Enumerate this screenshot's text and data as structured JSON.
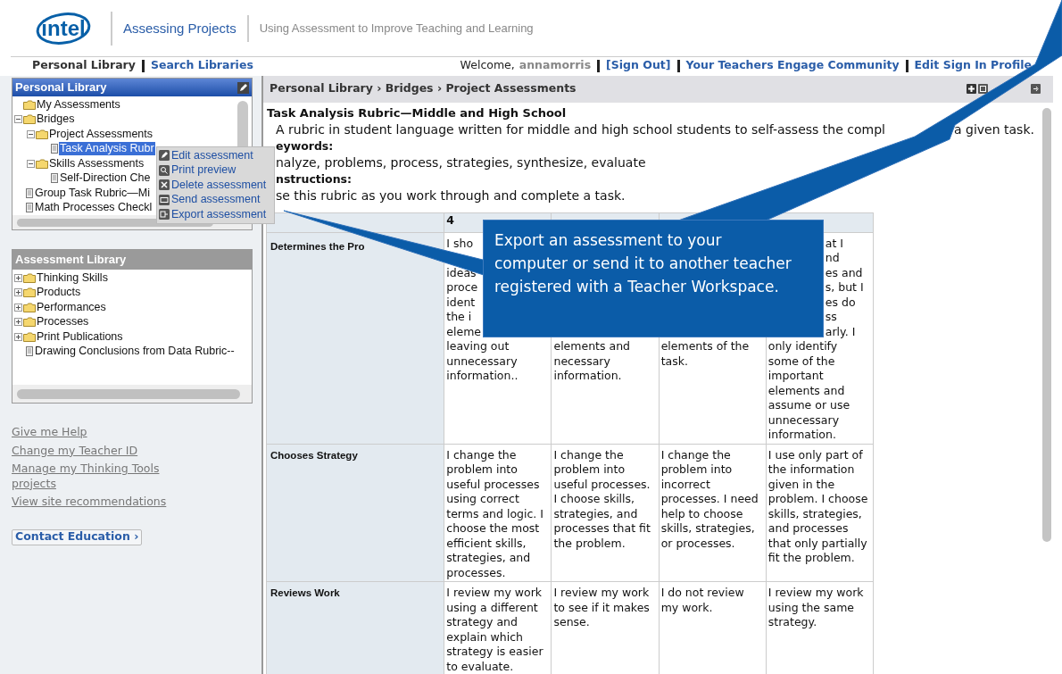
{
  "header": {
    "logo": "intel",
    "site_title": "Assessing Projects",
    "tagline": "Using Assessment to Improve Teaching and Learning"
  },
  "nav": {
    "tabs": [
      {
        "label": "Personal Library",
        "selected": true
      },
      {
        "label": "Search Libraries",
        "selected": false
      }
    ],
    "welcome": "Welcome,",
    "user": "annamorris",
    "links": [
      "[Sign Out]",
      "Your Teachers Engage Community",
      "Edit Sign In Profile"
    ]
  },
  "personal_library": {
    "title": "Personal Library",
    "tree": [
      {
        "label": "My Assessments",
        "kind": "folder",
        "selected": false
      },
      {
        "label": "Bridges",
        "kind": "folder",
        "expanded": true,
        "selected": false,
        "children": [
          {
            "label": "Project Assessments",
            "kind": "folder",
            "expanded": true,
            "selected": false,
            "children": [
              {
                "label": "Task Analysis Rubr",
                "kind": "doc",
                "selected": true
              }
            ]
          },
          {
            "label": "Skills Assessments",
            "kind": "folder",
            "expanded": true,
            "selected": false,
            "children": [
              {
                "label": "Self-Direction Che",
                "kind": "doc",
                "selected": false
              }
            ]
          }
        ]
      },
      {
        "label": "Group Task Rubric—Mi",
        "kind": "doc",
        "selected": false
      },
      {
        "label": "Math Processes Checkl",
        "kind": "doc",
        "selected": false
      }
    ]
  },
  "context_menu": [
    {
      "label": "Edit assessment",
      "kind": "edit"
    },
    {
      "label": "Print preview",
      "kind": "preview"
    },
    {
      "label": "Delete assessment",
      "kind": "delete"
    },
    {
      "label": "Send assessment",
      "kind": "send"
    },
    {
      "label": "Export assessment",
      "kind": "export"
    }
  ],
  "assessment_library": {
    "title": "Assessment Library",
    "tree": [
      {
        "label": "Thinking Skills",
        "kind": "folder",
        "expanded": false,
        "selected": false
      },
      {
        "label": "Products",
        "kind": "folder",
        "expanded": false,
        "selected": false
      },
      {
        "label": "Performances",
        "kind": "folder",
        "expanded": false,
        "selected": false
      },
      {
        "label": "Processes",
        "kind": "folder",
        "expanded": false,
        "selected": false
      },
      {
        "label": "Print Publications",
        "kind": "folder",
        "expanded": false,
        "selected": false
      },
      {
        "label": "Drawing Conclusions from Data Rubric--",
        "kind": "doc",
        "selected": false
      }
    ]
  },
  "side_links": [
    "Give me Help",
    "Change my Teacher ID",
    "Manage my Thinking Tools projects",
    "View site recommendations"
  ],
  "contact_button": "Contact Education ›",
  "main": {
    "breadcrumb": "Personal Library › Bridges › Project Assessments",
    "title": "Task Analysis Rubric—Middle and High School",
    "description": [
      "A rubric in student language written for middle and high school students to self-assess the compl",
      "a given task."
    ],
    "keywords_label": "eywords:",
    "keywords": "nalyze, problems, process, strategies, synthesize, evaluate",
    "instructions_label": "nstructions:",
    "instructions": "se this rubric as you work through and complete a task.",
    "table": {
      "columns": [
        "4"
      ],
      "rows": [
        {
          "label": "Determines the Pro",
          "cells": [
            {
              "above_pointer": [
                "I sho"
              ],
              "left_of_callout": [
                "ideas",
                "proce",
                "ident",
                "the i",
                "eleme"
              ],
              "below_callout": [
                "leaving out",
                "unnecessary",
                "information.."
              ]
            },
            {
              "below_callout": [
                "elements and",
                "necessary",
                "information."
              ]
            },
            {
              "below_callout": [
                "elements of the",
                "task."
              ]
            },
            {
              "right_of_callout": [
                "at I",
                "nd",
                "es and",
                "s, but I",
                "es do",
                "ss",
                "arly. I"
              ],
              "below_callout": [
                "only identify",
                "some of the",
                "important",
                "elements and",
                "assume or use",
                "unnecessary",
                "information."
              ]
            }
          ]
        },
        {
          "label": "Chooses Strategy",
          "cells": [
            {
              "text": "I change the problem into useful processes using correct terms and logic. I choose the most efficient skills, strategies, and processes."
            },
            {
              "text": "I change the problem into useful processes. I choose skills, strategies, and processes that fit the problem."
            },
            {
              "text": "I change the problem into incorrect processes. I need help to choose skills, strategies, or processes."
            },
            {
              "text": "I use only part of the information given in the problem. I choose skills, strategies, and processes that only partially fit the problem."
            }
          ]
        },
        {
          "label": "Reviews Work",
          "cells": [
            {
              "text": "I review my work using a different strategy and explain which strategy is easier to evaluate."
            },
            {
              "text": "I review my work to see if it makes sense."
            },
            {
              "text": "I do not review my work."
            },
            {
              "text": "I review my work using the same strategy."
            }
          ]
        }
      ]
    }
  },
  "callout": "Export an assessment to your computer or send it to another teacher registered with a Teacher Workspace."
}
